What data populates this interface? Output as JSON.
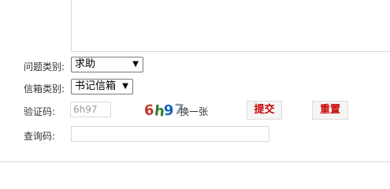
{
  "form": {
    "category": {
      "label": "问题类别:",
      "selected": "求助"
    },
    "mailbox": {
      "label": "信箱类别:",
      "selected": "书记信箱"
    },
    "captcha": {
      "label": "验证码:",
      "input_value": "6h97",
      "image_chars": [
        {
          "char": "6",
          "color": "#c0392b"
        },
        {
          "char": "h",
          "color": "#2e7d32"
        },
        {
          "char": "9",
          "color": "#1565c0"
        },
        {
          "char": "7",
          "color": "#8e9aa8"
        }
      ],
      "refresh_label": "换一张"
    },
    "buttons": {
      "submit_label": "提交",
      "reset_label": "重置"
    },
    "query": {
      "label": "查询码:",
      "value": ""
    }
  },
  "colors": {
    "button_text": "#cc0000",
    "border": "#d9d9d9"
  }
}
